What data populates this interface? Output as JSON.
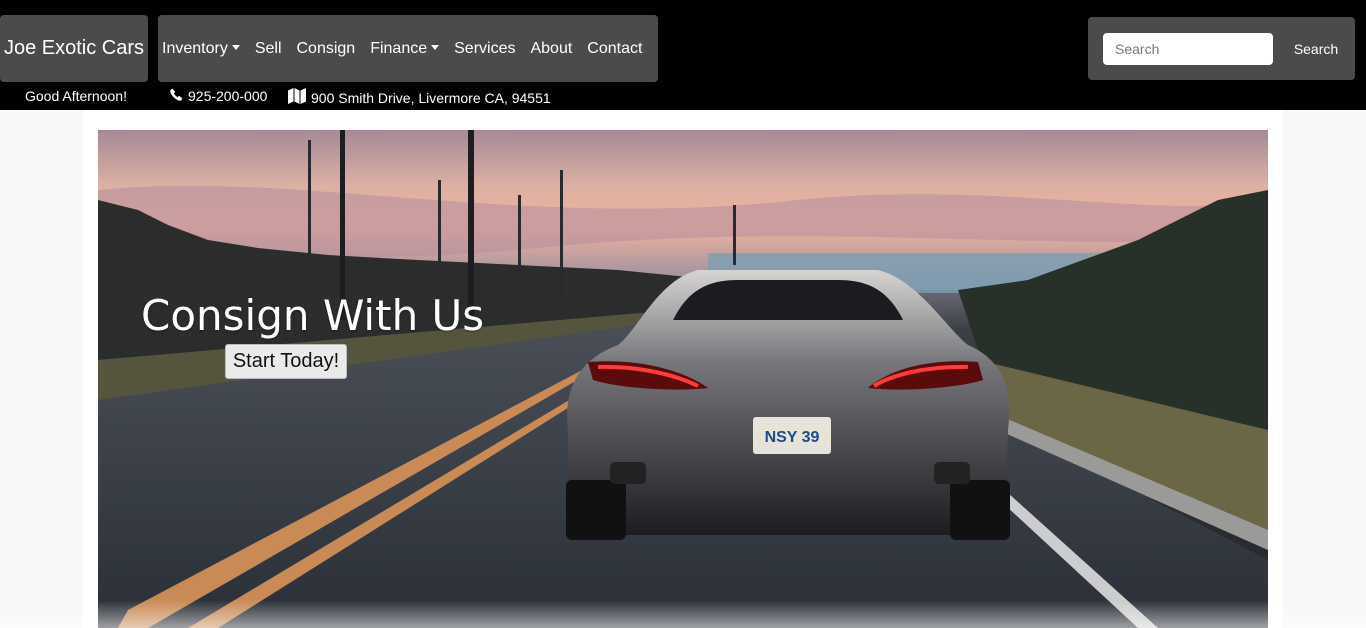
{
  "brand": {
    "name": "Joe Exotic Cars"
  },
  "nav": {
    "items": [
      {
        "label": "Inventory",
        "dropdown": true
      },
      {
        "label": "Sell",
        "dropdown": false
      },
      {
        "label": "Consign",
        "dropdown": false
      },
      {
        "label": "Finance",
        "dropdown": true
      },
      {
        "label": "Services",
        "dropdown": false
      },
      {
        "label": "About",
        "dropdown": false
      },
      {
        "label": "Contact",
        "dropdown": false
      }
    ]
  },
  "search": {
    "placeholder": "Search",
    "button_label": "Search"
  },
  "info": {
    "greeting": "Good Afternoon!",
    "phone": "925-200-000",
    "address": "900 Smith Drive, Livermore CA, 94551"
  },
  "hero": {
    "title": "Consign With Us",
    "cta_label": "Start Today!",
    "plate": "NSY 39"
  },
  "icons": {
    "phone": "phone-icon",
    "map": "map-icon",
    "caret": "chevron-down-icon"
  },
  "colors": {
    "topbar": "#000000",
    "panel": "#4b4b4b",
    "accent_taillight": "#ff3b3b"
  }
}
